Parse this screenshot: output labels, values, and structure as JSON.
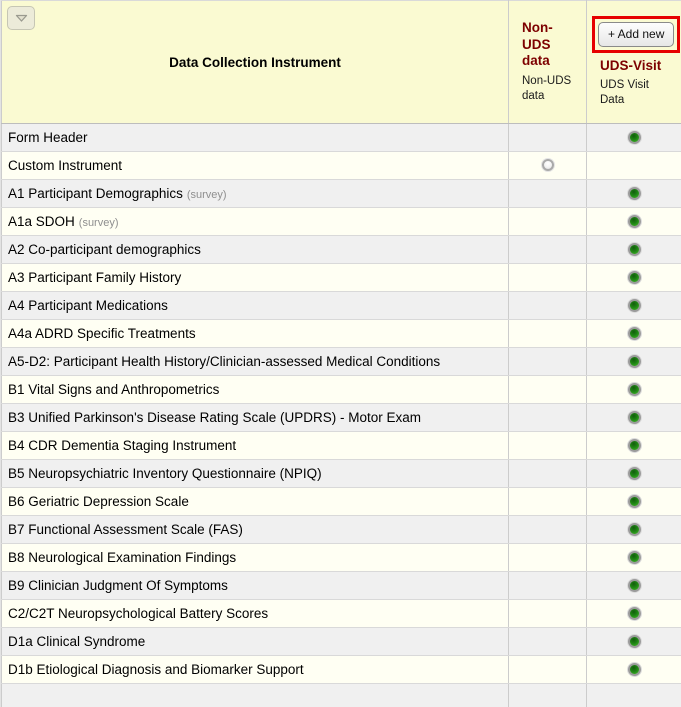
{
  "table": {
    "instrument_header": "Data Collection Instrument",
    "add_new_label": "+ Add new",
    "events": [
      {
        "title": "Non-UDS data",
        "subtitle": "Non-UDS data",
        "has_add_button": false
      },
      {
        "title": "UDS-Visit",
        "subtitle": "UDS Visit Data",
        "has_add_button": true
      }
    ],
    "rows": [
      {
        "label": "Form Header",
        "tag": "",
        "non_uds": "",
        "uds_visit": "green-dot"
      },
      {
        "label": "Custom Instrument",
        "tag": "",
        "non_uds": "radio-unchecked",
        "uds_visit": ""
      },
      {
        "label": "A1 Participant Demographics",
        "tag": "(survey)",
        "non_uds": "",
        "uds_visit": "green-dot"
      },
      {
        "label": "A1a SDOH",
        "tag": "(survey)",
        "non_uds": "",
        "uds_visit": "green-dot"
      },
      {
        "label": "A2 Co-participant demographics",
        "tag": "",
        "non_uds": "",
        "uds_visit": "green-dot"
      },
      {
        "label": "A3 Participant Family History",
        "tag": "",
        "non_uds": "",
        "uds_visit": "green-dot"
      },
      {
        "label": "A4 Participant Medications",
        "tag": "",
        "non_uds": "",
        "uds_visit": "green-dot"
      },
      {
        "label": "A4a ADRD Specific Treatments",
        "tag": "",
        "non_uds": "",
        "uds_visit": "green-dot"
      },
      {
        "label": "A5-D2: Participant Health History/Clinician-assessed Medical Conditions",
        "tag": "",
        "non_uds": "",
        "uds_visit": "green-dot"
      },
      {
        "label": "B1 Vital Signs and Anthropometrics",
        "tag": "",
        "non_uds": "",
        "uds_visit": "green-dot"
      },
      {
        "label": "B3 Unified Parkinson's Disease Rating Scale (UPDRS) - Motor Exam",
        "tag": "",
        "non_uds": "",
        "uds_visit": "green-dot"
      },
      {
        "label": "B4 CDR Dementia Staging Instrument",
        "tag": "",
        "non_uds": "",
        "uds_visit": "green-dot"
      },
      {
        "label": "B5 Neuropsychiatric Inventory Questionnaire (NPIQ)",
        "tag": "",
        "non_uds": "",
        "uds_visit": "green-dot"
      },
      {
        "label": "B6 Geriatric Depression Scale",
        "tag": "",
        "non_uds": "",
        "uds_visit": "green-dot"
      },
      {
        "label": "B7 Functional Assessment Scale (FAS)",
        "tag": "",
        "non_uds": "",
        "uds_visit": "green-dot"
      },
      {
        "label": "B8 Neurological Examination Findings",
        "tag": "",
        "non_uds": "",
        "uds_visit": "green-dot"
      },
      {
        "label": "B9 Clinician Judgment Of Symptoms",
        "tag": "",
        "non_uds": "",
        "uds_visit": "green-dot"
      },
      {
        "label": "C2/C2T Neuropsychological Battery Scores",
        "tag": "",
        "non_uds": "",
        "uds_visit": "green-dot"
      },
      {
        "label": "D1a Clinical Syndrome",
        "tag": "",
        "non_uds": "",
        "uds_visit": "green-dot"
      },
      {
        "label": "D1b Etiological Diagnosis and Biomarker Support",
        "tag": "",
        "non_uds": "",
        "uds_visit": "green-dot"
      }
    ]
  },
  "colors": {
    "header_bg": "#fafad2",
    "row_alt_bg": "#f0f0f0",
    "row_bg": "#fffff3",
    "event_title": "#7d0000",
    "status_green": "#1e8413",
    "highlight_red": "#e60000"
  }
}
